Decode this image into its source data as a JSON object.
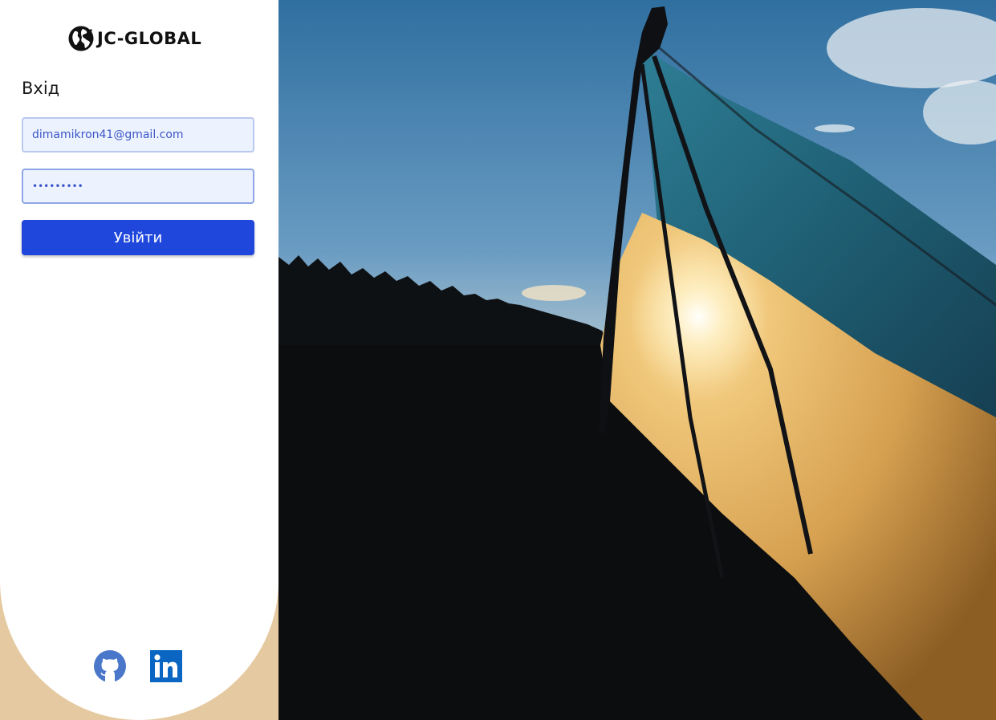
{
  "brand": {
    "name": "JC-GLOBAL",
    "logo_icon": "globe-icon"
  },
  "login": {
    "title": "Вхід",
    "email_value": "dimamikron41@gmail.com",
    "password_value": "•••••••••",
    "submit_label": "Увійти"
  },
  "social": [
    {
      "name": "GitHub",
      "icon": "github-icon"
    },
    {
      "name": "LinkedIn",
      "icon": "linkedin-icon"
    }
  ],
  "colors": {
    "accent": "#1f47dc",
    "input_bg": "#edf3fe",
    "input_text": "#3b56c8",
    "linkedin": "#0a66c2",
    "github": "#4a77c9"
  }
}
